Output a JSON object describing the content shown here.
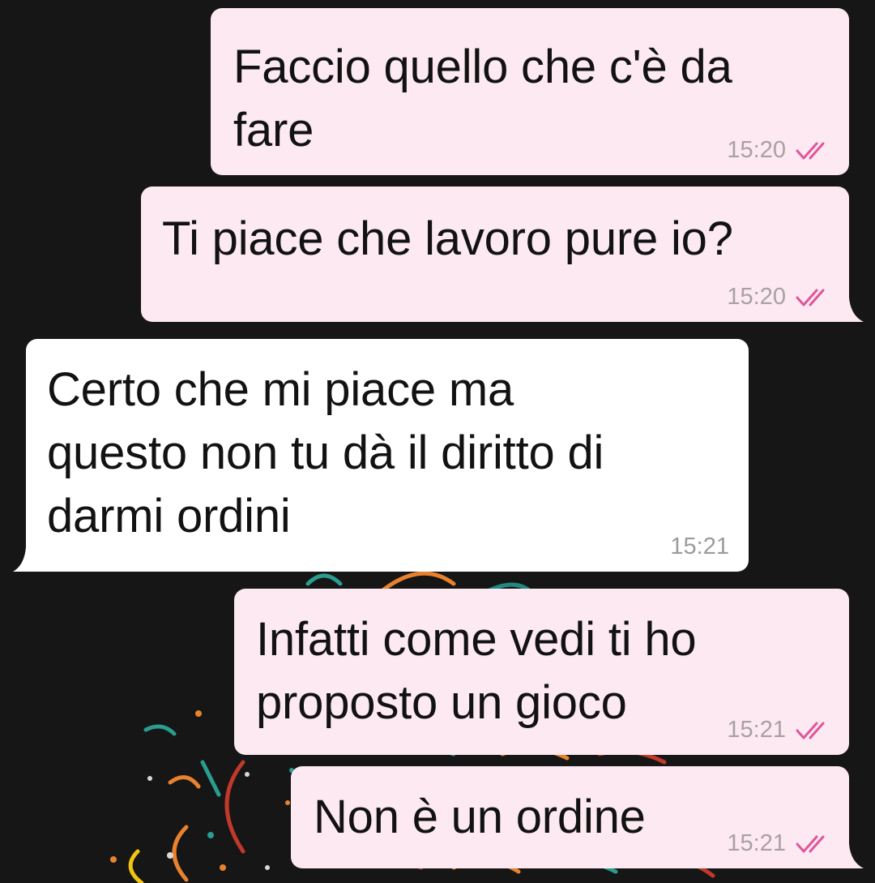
{
  "messages": [
    {
      "text": "Faccio quello che c'è da\nfare",
      "time": "15:20",
      "status": "read"
    },
    {
      "text": "Ti piace che lavoro pure io?",
      "time": "15:20",
      "status": "read"
    },
    {
      "text": "Certo che mi piace ma\nquesto non tu dà il diritto di\ndarmi ordini",
      "time": "15:21"
    },
    {
      "text": "Infatti come vedi ti ho\nproposto un gioco",
      "time": "15:21",
      "status": "read"
    },
    {
      "text": "Non è un ordine",
      "time": "15:21",
      "status": "read"
    }
  ],
  "colors": {
    "background": "#161616",
    "outgoing_bubble": "#fce9f1",
    "incoming_bubble": "#ffffff",
    "read_ticks": "#e0559a",
    "timestamp": "#a9a0a4"
  },
  "icons": {
    "read_receipt": "double-check-icon"
  }
}
